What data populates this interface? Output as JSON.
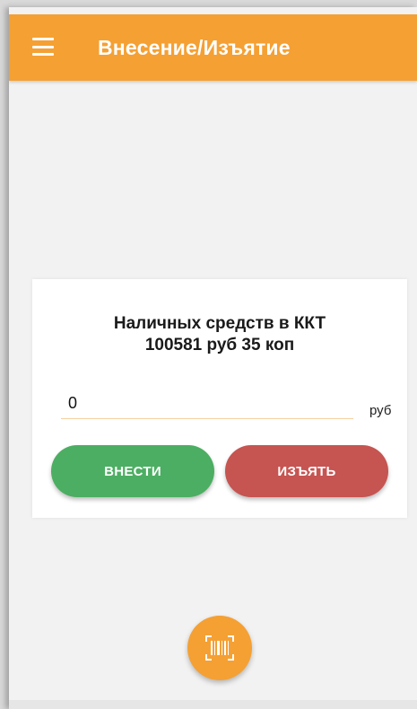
{
  "appbar": {
    "title": "Внесение/Изъятие",
    "menu_icon": "hamburger-menu-icon",
    "color": "#f5a033"
  },
  "cash_card": {
    "title_line1": "Наличных средств в ККТ",
    "title_line2": "100581 руб 35 коп",
    "amount_value": "0",
    "unit": "руб",
    "deposit_label": "ВНЕСТИ",
    "withdraw_label": "ИЗЪЯТЬ",
    "deposit_color": "#4cae62",
    "withdraw_color": "#c65451"
  },
  "fab": {
    "icon": "barcode-scanner-icon"
  }
}
